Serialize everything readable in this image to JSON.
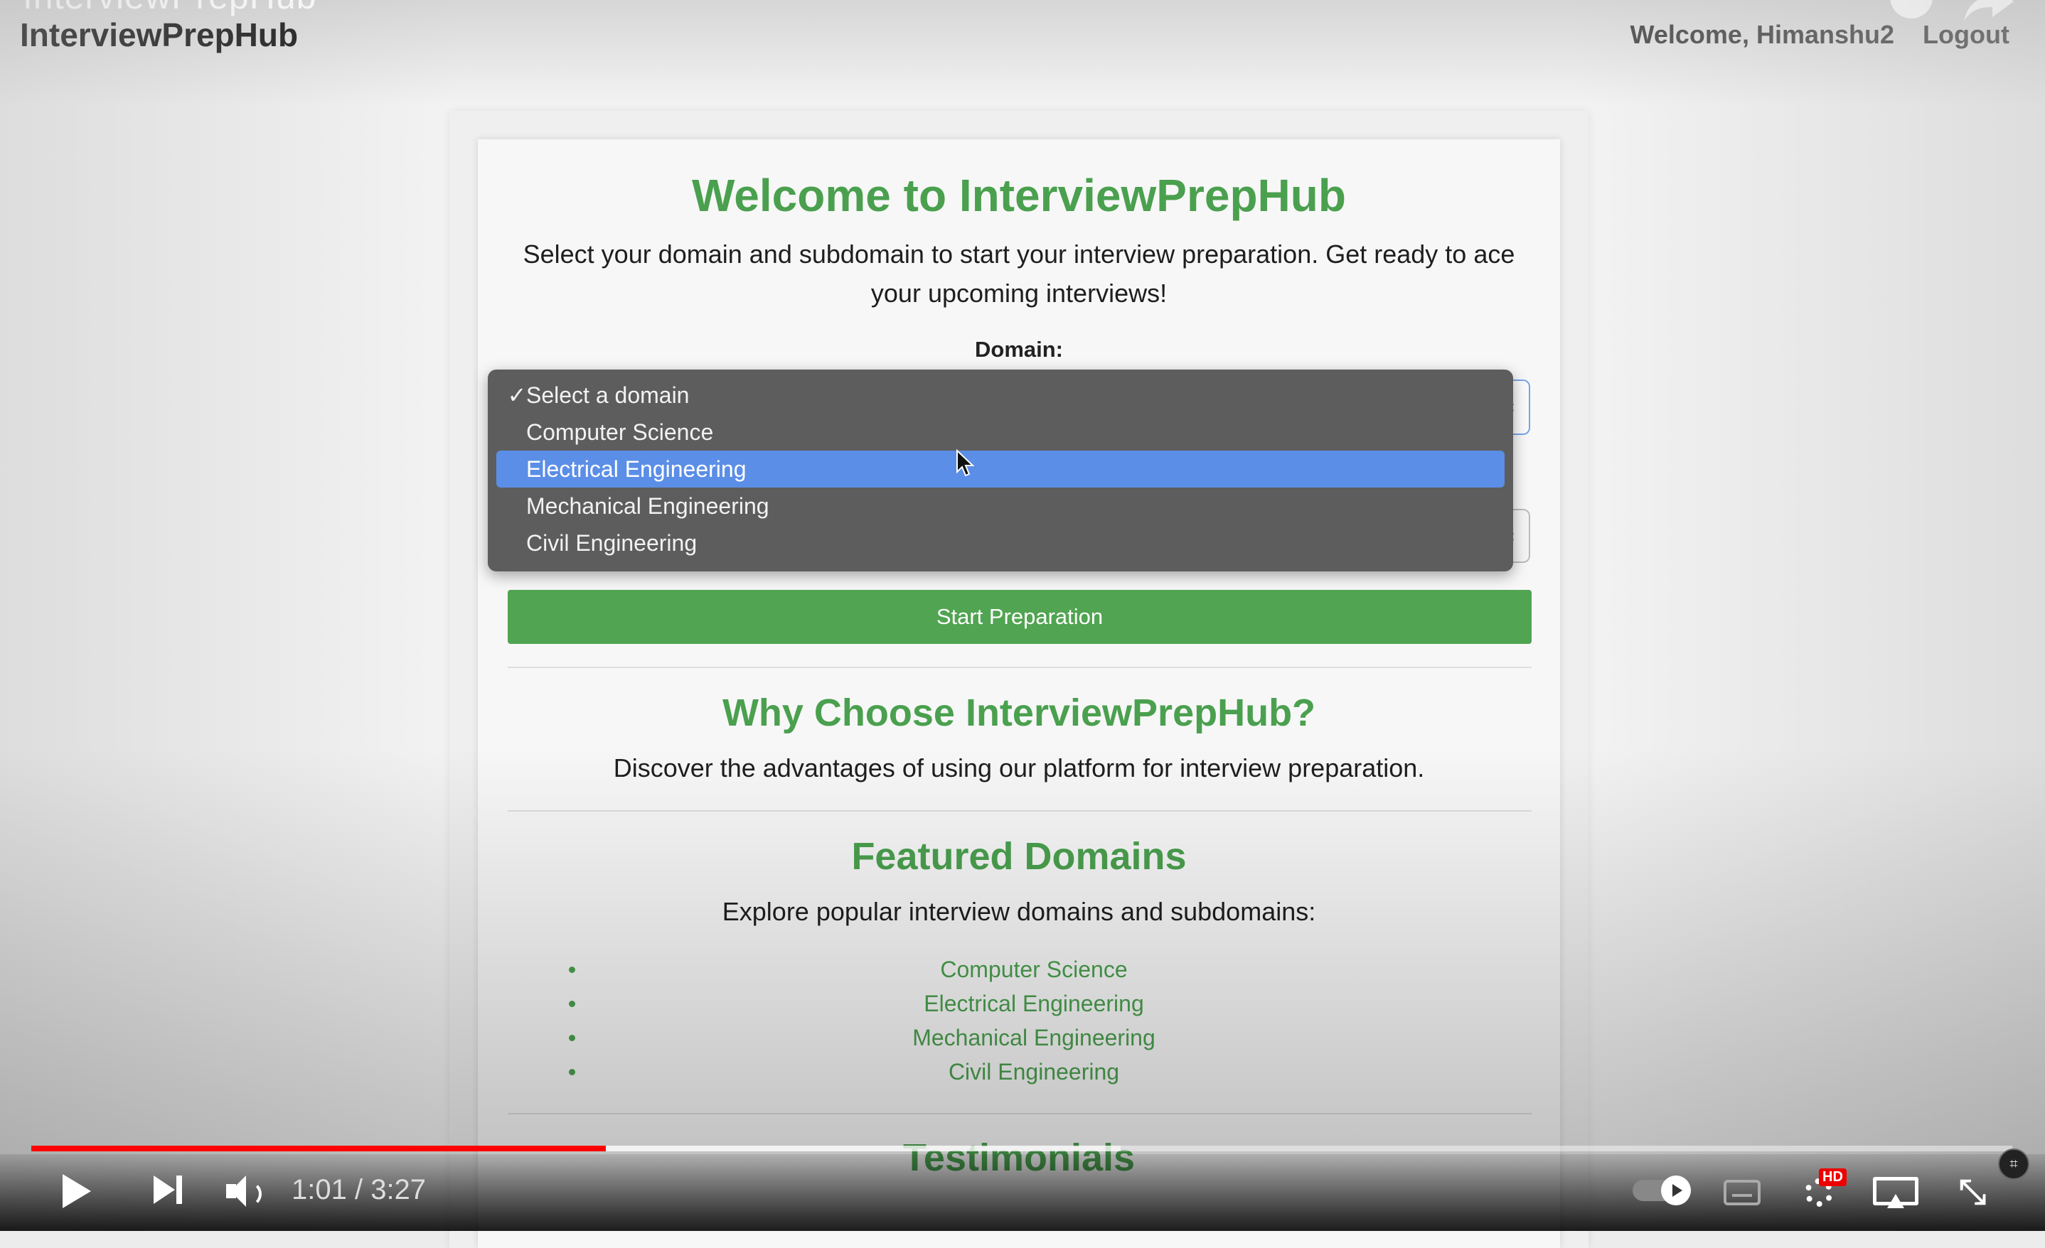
{
  "header": {
    "brand_ghost": "InterviewPrepHub",
    "brand": "InterviewPrepHub",
    "welcome": "Welcome, Himanshu2",
    "logout": "Logout"
  },
  "hero": {
    "title": "Welcome to InterviewPrepHub",
    "intro": "Select your domain and subdomain to start your interview preparation. Get ready to ace your upcoming interviews!",
    "domain_label": "Domain:"
  },
  "domain_select": {
    "selected": "Select a domain",
    "highlighted": "Electrical Engineering",
    "options": [
      {
        "check": "✓",
        "label": "Select a domain"
      },
      {
        "check": "",
        "label": "Computer Science"
      },
      {
        "check": "",
        "label": "Electrical Engineering"
      },
      {
        "check": "",
        "label": "Mechanical Engineering"
      },
      {
        "check": "",
        "label": "Civil Engineering"
      }
    ]
  },
  "start_button": "Start Preparation",
  "why": {
    "title": "Why Choose InterviewPrepHub?",
    "text": "Discover the advantages of using our platform for interview preparation."
  },
  "featured": {
    "title": "Featured Domains",
    "text": "Explore popular interview domains and subdomains:",
    "domains": [
      "Computer Science",
      "Electrical Engineering",
      "Mechanical Engineering",
      "Civil Engineering"
    ]
  },
  "testimonials": {
    "title": "Testimonials"
  },
  "player": {
    "time": "1:01 / 3:27",
    "played_fraction": 0.29,
    "buffered_fraction": 0.55,
    "hd_label": "HD",
    "colors": {
      "played": "#ff0000",
      "accent": "#4aa04e",
      "highlight": "#5b8ee6"
    }
  }
}
